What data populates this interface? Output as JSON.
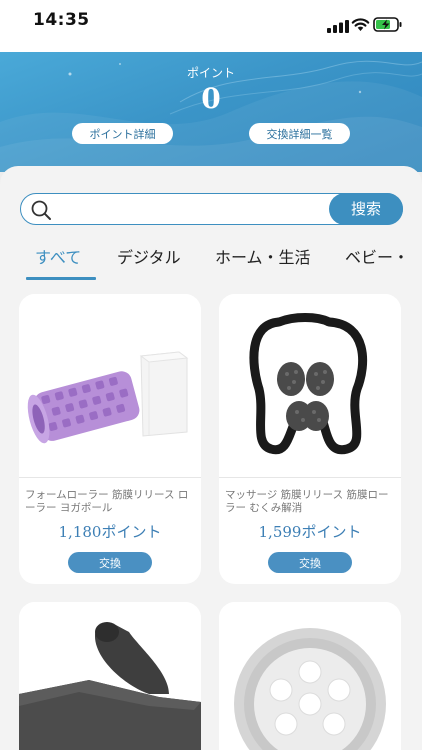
{
  "status_bar": {
    "time": "14:35"
  },
  "header": {
    "points_label": "ポイント",
    "points_value": "0",
    "point_detail_button": "ポイント詳細",
    "exchange_list_button": "交換詳細一覧"
  },
  "search": {
    "placeholder": "",
    "button_label": "搜索"
  },
  "tabs": [
    {
      "label": "すべて",
      "active": true
    },
    {
      "label": "デジタル",
      "active": false
    },
    {
      "label": "ホーム・生活",
      "active": false
    },
    {
      "label": "ベビー・",
      "active": false
    }
  ],
  "products": [
    {
      "name": "フォームローラー 筋膜リリース ローラー ヨガポール",
      "price": "1,180ポイント",
      "button": "交換",
      "image": "foam-roller"
    },
    {
      "name": "マッサージ 筋膜リリース 筋膜ローラー むくみ解消",
      "price": "1,599ポイント",
      "button": "交換",
      "image": "massage-roller"
    },
    {
      "name": "",
      "price": "",
      "button": "",
      "image": "yoga-mat"
    },
    {
      "name": "",
      "price": "",
      "button": "",
      "image": "led-light"
    }
  ],
  "colors": {
    "accent": "#3d8fc0",
    "header_blue": "#3b95c8",
    "price": "#3d7fb5"
  }
}
